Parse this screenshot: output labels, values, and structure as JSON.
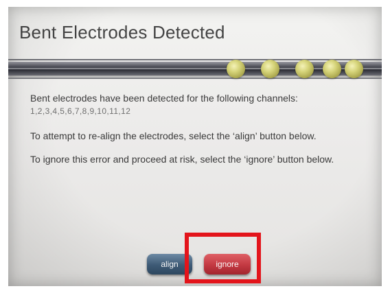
{
  "dialog": {
    "title": "Bent Electrodes Detected",
    "message_line1": "Bent electrodes have been detected for the following channels:",
    "channels": "1,2,3,4,5,6,7,8,9,10,11,12",
    "message_align": "To attempt to re-align the electrodes, select the ‘align’ button below.",
    "message_ignore": "To ignore this error and proceed at risk, select the ‘ignore’ button below."
  },
  "progress": {
    "step_indicators": 5
  },
  "buttons": {
    "align_label": "align",
    "ignore_label": "ignore"
  },
  "colors": {
    "highlight_box": "#e3141b",
    "align_button": "#3f5c78",
    "ignore_button": "#c73a43",
    "step_dot": "#d6d47a"
  }
}
